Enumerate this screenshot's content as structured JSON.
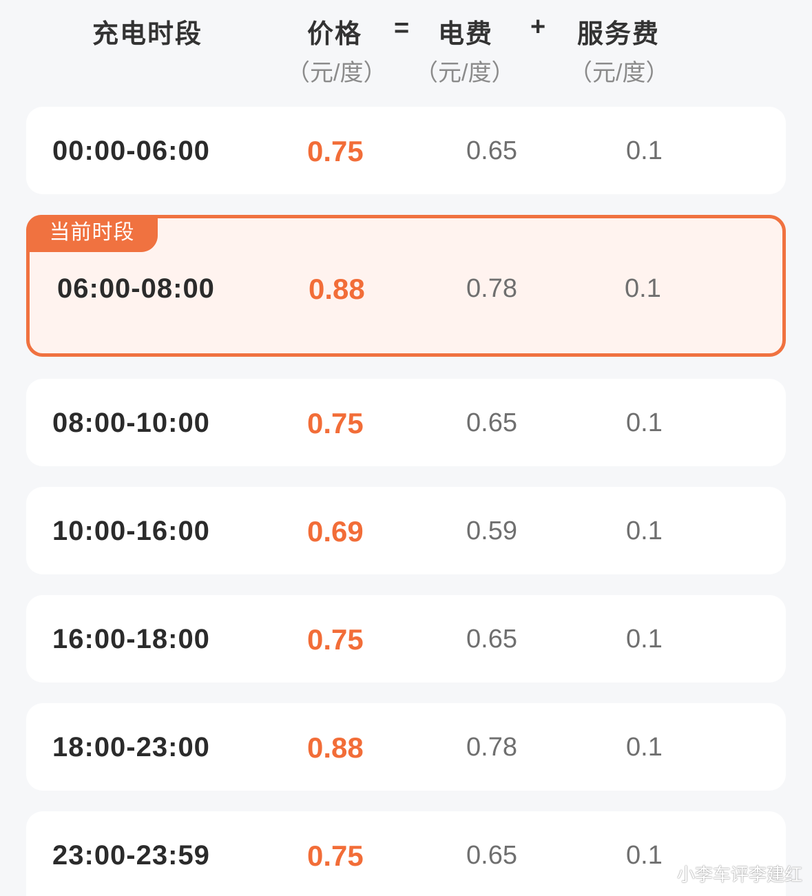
{
  "header": {
    "col_time": "充电时段",
    "col_price": "价格",
    "op_equals": "=",
    "col_elec": "电费",
    "op_plus": "+",
    "col_service": "服务费",
    "unit": "（元/度）"
  },
  "current_badge": "当前时段",
  "rows": [
    {
      "time": "00:00-06:00",
      "price": "0.75",
      "elec": "0.65",
      "service": "0.1"
    },
    {
      "time": "06:00-08:00",
      "price": "0.88",
      "elec": "0.78",
      "service": "0.1"
    },
    {
      "time": "08:00-10:00",
      "price": "0.75",
      "elec": "0.65",
      "service": "0.1"
    },
    {
      "time": "10:00-16:00",
      "price": "0.69",
      "elec": "0.59",
      "service": "0.1"
    },
    {
      "time": "16:00-18:00",
      "price": "0.75",
      "elec": "0.65",
      "service": "0.1"
    },
    {
      "time": "18:00-23:00",
      "price": "0.88",
      "elec": "0.78",
      "service": "0.1"
    },
    {
      "time": "23:00-23:59",
      "price": "0.75",
      "elec": "0.65",
      "service": "0.1"
    }
  ],
  "watermark": "小李车评李建红",
  "colors": {
    "accent": "#f07240",
    "price": "#f26d38",
    "background": "#f6f7f9",
    "current_row_bg": "#fff3ef"
  }
}
